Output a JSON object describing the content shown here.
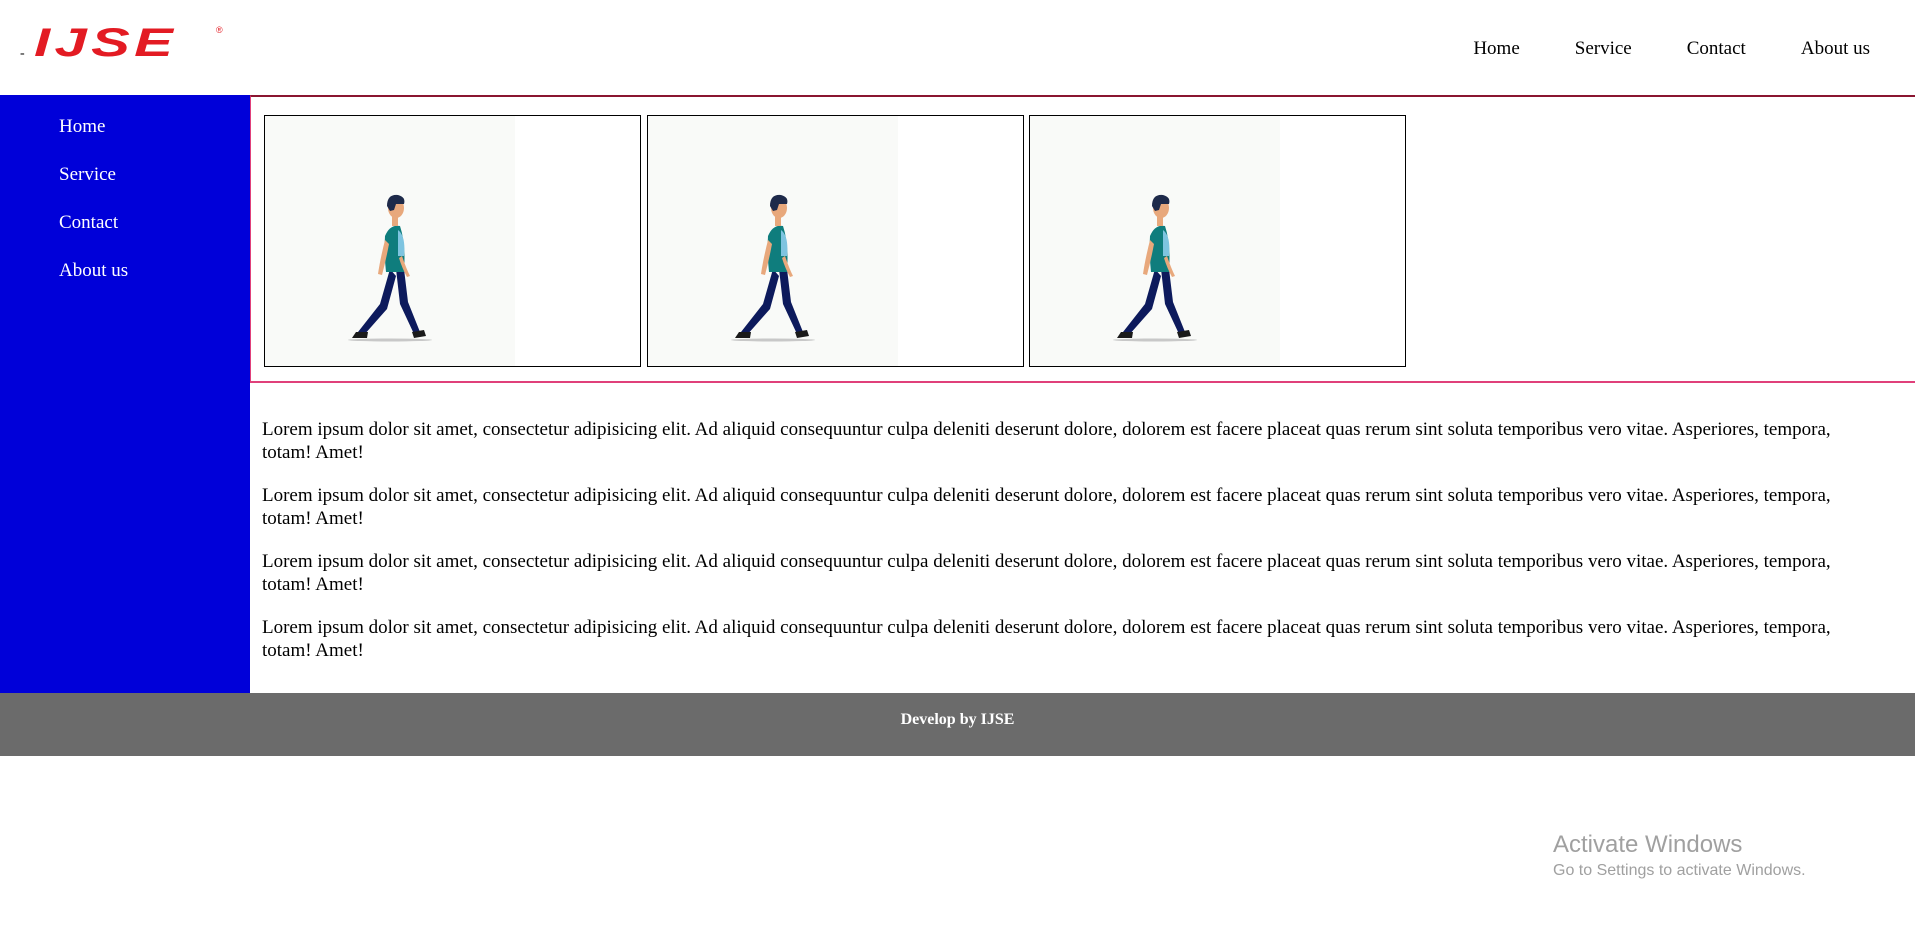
{
  "header": {
    "logo_dash": "-",
    "logo_text": "IJSE",
    "logo_reg": "®",
    "nav": [
      "Home",
      "Service",
      "Contact",
      "About us"
    ]
  },
  "sidebar": {
    "items": [
      "Home",
      "Service",
      "Contact",
      "About us"
    ]
  },
  "gallery": {
    "images": [
      {
        "icon": "walking-man-image"
      },
      {
        "icon": "walking-man-image"
      },
      {
        "icon": "walking-man-image"
      }
    ]
  },
  "content": {
    "paragraphs": [
      "Lorem ipsum dolor sit amet, consectetur adipisicing elit. Ad aliquid consequuntur culpa deleniti deserunt dolore, dolorem est facere placeat quas rerum sint soluta temporibus vero vitae. Asperiores, tempora, totam! Amet!",
      "Lorem ipsum dolor sit amet, consectetur adipisicing elit. Ad aliquid consequuntur culpa deleniti deserunt dolore, dolorem est facere placeat quas rerum sint soluta temporibus vero vitae. Asperiores, tempora, totam! Amet!",
      "Lorem ipsum dolor sit amet, consectetur adipisicing elit. Ad aliquid consequuntur culpa deleniti deserunt dolore, dolorem est facere placeat quas rerum sint soluta temporibus vero vitae. Asperiores, tempora, totam! Amet!",
      "Lorem ipsum dolor sit amet, consectetur adipisicing elit. Ad aliquid consequuntur culpa deleniti deserunt dolore, dolorem est facere placeat quas rerum sint soluta temporibus vero vitae. Asperiores, tempora, totam! Amet!"
    ]
  },
  "footer": {
    "text": "Develop by IJSE"
  },
  "watermark": {
    "title": "Activate Windows",
    "subtitle": "Go to Settings to activate Windows."
  },
  "colors": {
    "sidebar_bg": "#0000d9",
    "footer_bg": "#6b6b6b",
    "logo_red": "#e31b23",
    "gallery_border": "#e0407a"
  }
}
